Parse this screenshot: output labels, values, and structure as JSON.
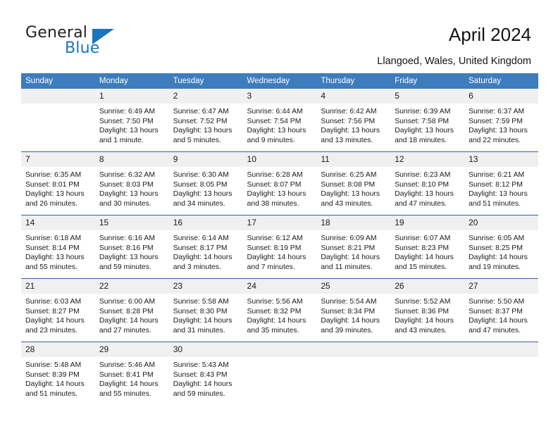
{
  "logo": {
    "text_top": "General",
    "text_bottom": "Blue",
    "triangle_icon": "triangle-icon",
    "brand_color": "#1b75bb"
  },
  "header": {
    "title": "April 2024",
    "subtitle": "Llangoed, Wales, United Kingdom"
  },
  "calendar": {
    "header_color": "#3d7cbd",
    "weekday_headers": [
      "Sunday",
      "Monday",
      "Tuesday",
      "Wednesday",
      "Thursday",
      "Friday",
      "Saturday"
    ],
    "weeks": [
      [
        {
          "day": "",
          "lines": []
        },
        {
          "day": "1",
          "lines": [
            "Sunrise: 6:49 AM",
            "Sunset: 7:50 PM",
            "Daylight: 13 hours",
            "and 1 minute."
          ]
        },
        {
          "day": "2",
          "lines": [
            "Sunrise: 6:47 AM",
            "Sunset: 7:52 PM",
            "Daylight: 13 hours",
            "and 5 minutes."
          ]
        },
        {
          "day": "3",
          "lines": [
            "Sunrise: 6:44 AM",
            "Sunset: 7:54 PM",
            "Daylight: 13 hours",
            "and 9 minutes."
          ]
        },
        {
          "day": "4",
          "lines": [
            "Sunrise: 6:42 AM",
            "Sunset: 7:56 PM",
            "Daylight: 13 hours",
            "and 13 minutes."
          ]
        },
        {
          "day": "5",
          "lines": [
            "Sunrise: 6:39 AM",
            "Sunset: 7:58 PM",
            "Daylight: 13 hours",
            "and 18 minutes."
          ]
        },
        {
          "day": "6",
          "lines": [
            "Sunrise: 6:37 AM",
            "Sunset: 7:59 PM",
            "Daylight: 13 hours",
            "and 22 minutes."
          ]
        }
      ],
      [
        {
          "day": "7",
          "lines": [
            "Sunrise: 6:35 AM",
            "Sunset: 8:01 PM",
            "Daylight: 13 hours",
            "and 26 minutes."
          ]
        },
        {
          "day": "8",
          "lines": [
            "Sunrise: 6:32 AM",
            "Sunset: 8:03 PM",
            "Daylight: 13 hours",
            "and 30 minutes."
          ]
        },
        {
          "day": "9",
          "lines": [
            "Sunrise: 6:30 AM",
            "Sunset: 8:05 PM",
            "Daylight: 13 hours",
            "and 34 minutes."
          ]
        },
        {
          "day": "10",
          "lines": [
            "Sunrise: 6:28 AM",
            "Sunset: 8:07 PM",
            "Daylight: 13 hours",
            "and 38 minutes."
          ]
        },
        {
          "day": "11",
          "lines": [
            "Sunrise: 6:25 AM",
            "Sunset: 8:08 PM",
            "Daylight: 13 hours",
            "and 43 minutes."
          ]
        },
        {
          "day": "12",
          "lines": [
            "Sunrise: 6:23 AM",
            "Sunset: 8:10 PM",
            "Daylight: 13 hours",
            "and 47 minutes."
          ]
        },
        {
          "day": "13",
          "lines": [
            "Sunrise: 6:21 AM",
            "Sunset: 8:12 PM",
            "Daylight: 13 hours",
            "and 51 minutes."
          ]
        }
      ],
      [
        {
          "day": "14",
          "lines": [
            "Sunrise: 6:18 AM",
            "Sunset: 8:14 PM",
            "Daylight: 13 hours",
            "and 55 minutes."
          ]
        },
        {
          "day": "15",
          "lines": [
            "Sunrise: 6:16 AM",
            "Sunset: 8:16 PM",
            "Daylight: 13 hours",
            "and 59 minutes."
          ]
        },
        {
          "day": "16",
          "lines": [
            "Sunrise: 6:14 AM",
            "Sunset: 8:17 PM",
            "Daylight: 14 hours",
            "and 3 minutes."
          ]
        },
        {
          "day": "17",
          "lines": [
            "Sunrise: 6:12 AM",
            "Sunset: 8:19 PM",
            "Daylight: 14 hours",
            "and 7 minutes."
          ]
        },
        {
          "day": "18",
          "lines": [
            "Sunrise: 6:09 AM",
            "Sunset: 8:21 PM",
            "Daylight: 14 hours",
            "and 11 minutes."
          ]
        },
        {
          "day": "19",
          "lines": [
            "Sunrise: 6:07 AM",
            "Sunset: 8:23 PM",
            "Daylight: 14 hours",
            "and 15 minutes."
          ]
        },
        {
          "day": "20",
          "lines": [
            "Sunrise: 6:05 AM",
            "Sunset: 8:25 PM",
            "Daylight: 14 hours",
            "and 19 minutes."
          ]
        }
      ],
      [
        {
          "day": "21",
          "lines": [
            "Sunrise: 6:03 AM",
            "Sunset: 8:27 PM",
            "Daylight: 14 hours",
            "and 23 minutes."
          ]
        },
        {
          "day": "22",
          "lines": [
            "Sunrise: 6:00 AM",
            "Sunset: 8:28 PM",
            "Daylight: 14 hours",
            "and 27 minutes."
          ]
        },
        {
          "day": "23",
          "lines": [
            "Sunrise: 5:58 AM",
            "Sunset: 8:30 PM",
            "Daylight: 14 hours",
            "and 31 minutes."
          ]
        },
        {
          "day": "24",
          "lines": [
            "Sunrise: 5:56 AM",
            "Sunset: 8:32 PM",
            "Daylight: 14 hours",
            "and 35 minutes."
          ]
        },
        {
          "day": "25",
          "lines": [
            "Sunrise: 5:54 AM",
            "Sunset: 8:34 PM",
            "Daylight: 14 hours",
            "and 39 minutes."
          ]
        },
        {
          "day": "26",
          "lines": [
            "Sunrise: 5:52 AM",
            "Sunset: 8:36 PM",
            "Daylight: 14 hours",
            "and 43 minutes."
          ]
        },
        {
          "day": "27",
          "lines": [
            "Sunrise: 5:50 AM",
            "Sunset: 8:37 PM",
            "Daylight: 14 hours",
            "and 47 minutes."
          ]
        }
      ],
      [
        {
          "day": "28",
          "lines": [
            "Sunrise: 5:48 AM",
            "Sunset: 8:39 PM",
            "Daylight: 14 hours",
            "and 51 minutes."
          ]
        },
        {
          "day": "29",
          "lines": [
            "Sunrise: 5:46 AM",
            "Sunset: 8:41 PM",
            "Daylight: 14 hours",
            "and 55 minutes."
          ]
        },
        {
          "day": "30",
          "lines": [
            "Sunrise: 5:43 AM",
            "Sunset: 8:43 PM",
            "Daylight: 14 hours",
            "and 59 minutes."
          ]
        },
        {
          "day": "",
          "lines": []
        },
        {
          "day": "",
          "lines": []
        },
        {
          "day": "",
          "lines": []
        },
        {
          "day": "",
          "lines": []
        }
      ]
    ]
  }
}
